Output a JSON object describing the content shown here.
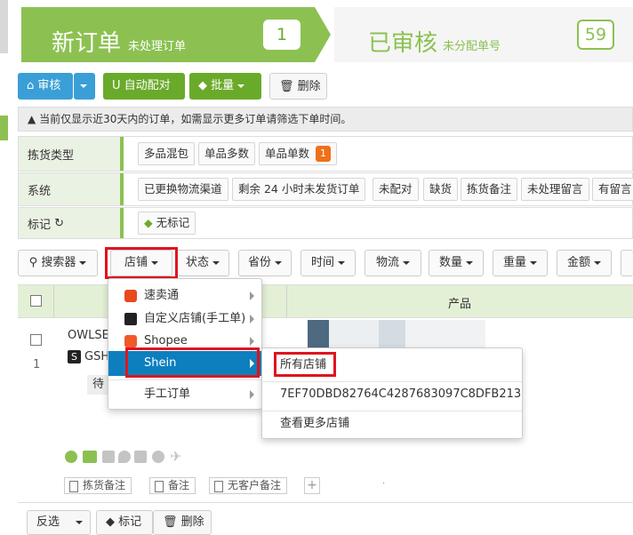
{
  "steps": {
    "new": {
      "title": "新订单",
      "subtitle": "未处理订单",
      "count": "1"
    },
    "reviewed": {
      "title": "已审核",
      "subtitle": "未分配单号",
      "count": "59"
    }
  },
  "toolbar": {
    "review": "审核",
    "auto_match": "自动配对",
    "batch": "批量",
    "delete": "删除"
  },
  "notice": "当前仅显示近30天内的订单，如需显示更多订单请筛选下单时间。",
  "filters": {
    "pick_type": {
      "label": "拣货类型",
      "options": [
        "多品混包",
        "单品多数",
        "单品单数"
      ],
      "badge": "1"
    },
    "system": {
      "label": "系统",
      "options": [
        "已更换物流渠道",
        "剩余 24 小时未发货订单",
        "未配对",
        "缺货",
        "拣货备注",
        "未处理留言",
        "有留言"
      ]
    },
    "tag": {
      "label": "标记",
      "options": [
        "无标记"
      ]
    }
  },
  "filter_buttons": [
    "搜索器",
    "店铺",
    "状态",
    "省份",
    "时间",
    "物流",
    "数量",
    "重量",
    "金额"
  ],
  "table": {
    "product_header": "产品",
    "row_index": "1",
    "row_id_fragment": "OWLSE",
    "row_store_fragment": "GSH",
    "row_status_fragment": "待"
  },
  "store_menu": [
    "速卖通",
    "自定义店铺(手工单)",
    "Shopee",
    "Shein",
    "手工订单"
  ],
  "shein_submenu": [
    "所有店铺",
    "7EF70DBD82764C4287683097C8DFB213",
    "查看更多店铺"
  ],
  "row_notes": [
    "拣货备注",
    "备注",
    "无客户备注"
  ],
  "bottom_bar": {
    "invert": "反选",
    "tag": "标记",
    "delete": "删除"
  },
  "colors": {
    "accent_green": "#8cc152",
    "button_green": "#6aaa2a",
    "button_blue": "#3a9fd6",
    "menu_selected": "#0d7fbf",
    "highlight_red": "#e0141e",
    "badge_orange": "#f0701a"
  }
}
